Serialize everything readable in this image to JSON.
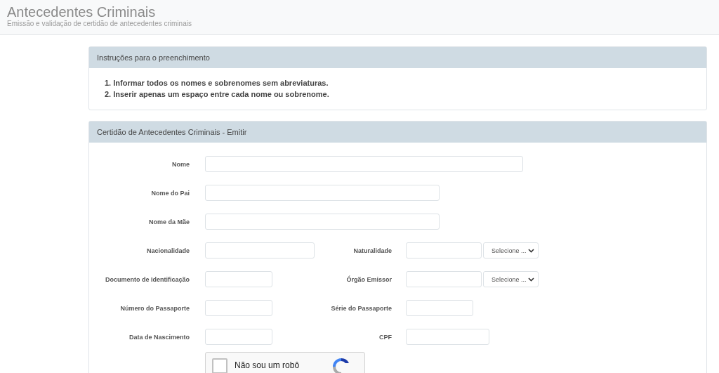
{
  "header": {
    "title": "Antecedentes Criminais",
    "subtitle": "Emissão e validação de certidão de antecedentes criminais"
  },
  "instructions": {
    "title": "Instruções para o preenchimento",
    "items": [
      "1. Informar todos os nomes e sobrenomes sem abreviaturas.",
      "2. Inserir apenas um espaço entre cada nome ou sobrenome."
    ]
  },
  "form": {
    "title": "Certidão de Antecedentes Criminais - Emitir",
    "rows": [
      {
        "fields": [
          {
            "label": "Nome",
            "kind": "full"
          }
        ]
      },
      {
        "fields": [
          {
            "label": "Nome do Pai",
            "kind": "long"
          }
        ]
      },
      {
        "fields": [
          {
            "label": "Nome da Mãe",
            "kind": "long"
          }
        ]
      },
      {
        "fields": [
          {
            "label": "Nacionalidade",
            "kind": "medium"
          },
          {
            "label": "Naturalidade",
            "kind": "combo",
            "select": "Selecione ..."
          }
        ]
      },
      {
        "fields": [
          {
            "label": "Documento de Identificação",
            "kind": "short"
          },
          {
            "label": "Órgão Emissor",
            "kind": "combo",
            "select": "Selecione ..."
          }
        ]
      },
      {
        "fields": [
          {
            "label": "Número do Passaporte",
            "kind": "short"
          },
          {
            "label": "Série do Passaporte",
            "kind": "short"
          }
        ]
      },
      {
        "fields": [
          {
            "label": "Data de Nascimento",
            "kind": "short"
          },
          {
            "label": "CPF",
            "kind": "wide"
          }
        ]
      }
    ],
    "captcha": {
      "label": "Não sou um robô",
      "checked": false
    }
  }
}
